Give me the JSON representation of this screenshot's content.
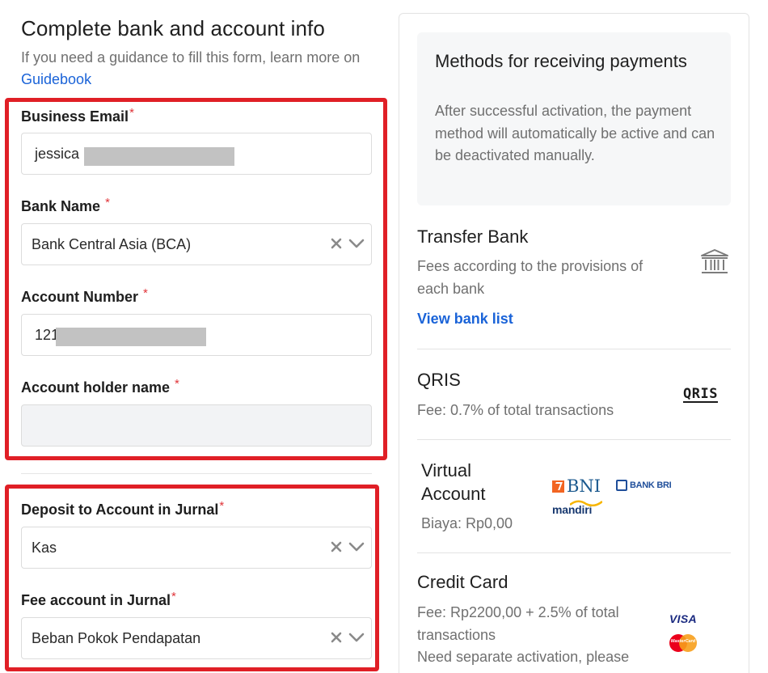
{
  "form": {
    "title": "Complete bank and account info",
    "subtitle_prefix": "If you need a guidance to fill this form, learn more on ",
    "guidebook_link": "Guidebook",
    "required_mark": "*",
    "business_email": {
      "label": "Business Email",
      "value": "jessica"
    },
    "bank_name": {
      "label": "Bank Name",
      "value": "Bank Central Asia (BCA)"
    },
    "account_number": {
      "label": "Account Number",
      "value": "121"
    },
    "account_holder_name": {
      "label": "Account holder name",
      "value": ""
    },
    "deposit_account": {
      "label": "Deposit to Account in Jurnal",
      "value": "Kas"
    },
    "fee_account": {
      "label": "Fee account in Jurnal",
      "value": "Beban Pokok Pendapatan"
    }
  },
  "sidebar": {
    "title": "Methods for receiving payments",
    "description": "After successful activation, the payment method will automatically be active and can be deactivated manually.",
    "methods": [
      {
        "name": "Transfer Bank",
        "description": "Fees according to the provisions of each bank",
        "link": "View bank list",
        "icon": "bank-icon"
      },
      {
        "name": "QRIS",
        "description": "Fee: 0.7% of total transactions",
        "logo": "QRIS"
      },
      {
        "name": "Virtual Account",
        "description": "Biaya: Rp0,00",
        "logos": [
          "BNI",
          "BANK BRI",
          "mandiri"
        ]
      },
      {
        "name": "Credit Card",
        "description": "Fee: Rp2200,00 + 2.5% of total transactions",
        "note": "Need separate activation, please",
        "logos": [
          "VISA",
          "MasterCard"
        ]
      }
    ]
  },
  "colors": {
    "link": "#1a63d8",
    "highlight": "#e01f26",
    "required": "#e0353a"
  }
}
